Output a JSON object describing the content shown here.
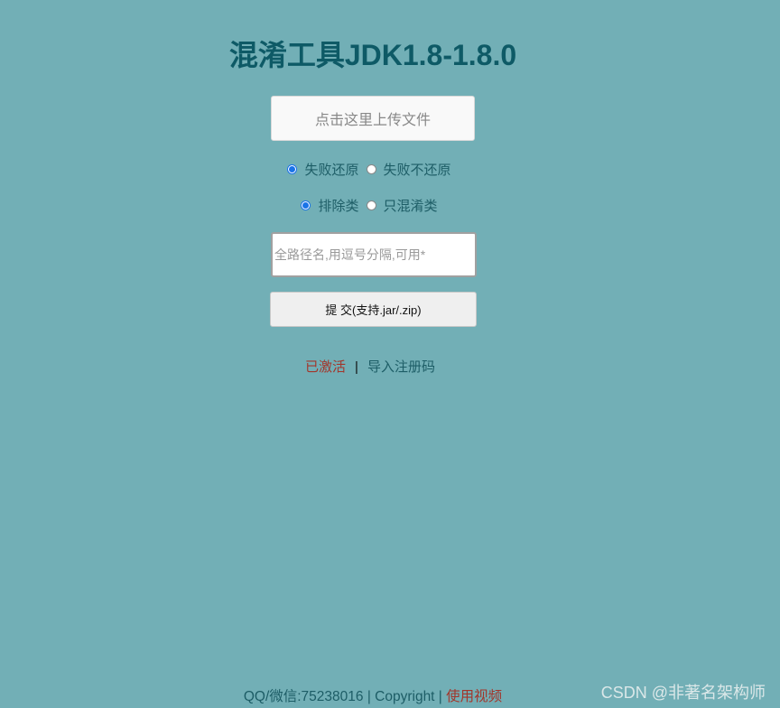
{
  "header": {
    "title": "混淆工具JDK1.8-1.8.0"
  },
  "upload": {
    "label": "点击这里上传文件"
  },
  "restore_options": {
    "options": [
      {
        "label": "失败还原",
        "checked": true
      },
      {
        "label": "失败不还原",
        "checked": false
      }
    ]
  },
  "class_options": {
    "options": [
      {
        "label": "排除类",
        "checked": true
      },
      {
        "label": "只混淆类",
        "checked": false
      }
    ]
  },
  "package_input": {
    "placeholder": "全路径名,用逗号分隔,可用*",
    "value": ""
  },
  "submit": {
    "label": "提 交(支持.jar/.zip)"
  },
  "activation": {
    "status": "已激活",
    "separator": "|",
    "import_label": "导入注册码"
  },
  "footer": {
    "contact": "QQ/微信:75238016 | Copyright | ",
    "video_link": "使用视频"
  },
  "watermark": {
    "text": "CSDN @非著名架构师"
  },
  "colors": {
    "background": "#72afb6",
    "title": "#0e5a66",
    "accent_red": "#a3352a",
    "text_teal": "#1d5d66",
    "radio_checked": "#1a73e8"
  }
}
